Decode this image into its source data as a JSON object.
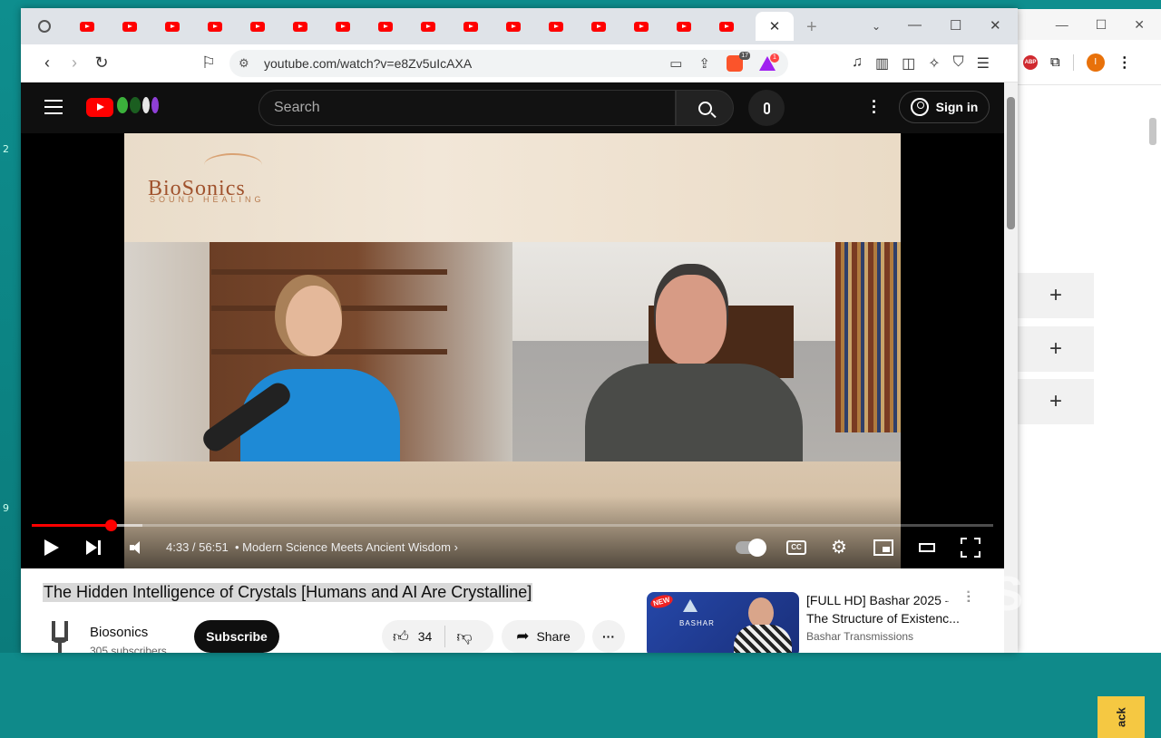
{
  "desktop": {
    "marks": [
      "2",
      "9"
    ]
  },
  "browser": {
    "tabs_count": 16,
    "active_tab_close": "✕",
    "new_tab": "+",
    "window_controls": {
      "minimize": "—",
      "maximize": "☐",
      "close": "✕"
    },
    "address": {
      "url": "youtube.com/watch?v=e8Zv5uIcAXA"
    },
    "brave_shield_count": "17",
    "rewards_count": "1"
  },
  "bg_browser": {
    "plus_rows": [
      "+",
      "+",
      "+"
    ],
    "feedback_label": "ack",
    "profile_initial": "I",
    "abp_label": "ABP"
  },
  "youtube": {
    "search": {
      "placeholder": "Search"
    },
    "sign_in": "Sign in",
    "player": {
      "time": "4:33 / 56:51",
      "chapter": "Modern Science Meets Ancient Wisdom",
      "chapter_chevron": "›",
      "progress_fraction": 0.0818,
      "buffered_fraction": 0.115,
      "cc_label": "CC",
      "video_brand": "BioSonics",
      "video_brand_sub": "SOUND HEALING"
    },
    "video": {
      "title": "The Hidden Intelligence of Crystals [Humans and AI Are Crystalline]",
      "channel": "Biosonics",
      "subscribers": "305 subscribers",
      "subscribe_label": "Subscribe",
      "likes": "34",
      "share_label": "Share",
      "more_label": "···"
    },
    "recommended": [
      {
        "title": "[FULL HD] Bashar 2025 - The Structure of Existenc...",
        "channel": "Bashar Transmissions",
        "thumb_badge": "NEW",
        "thumb_text": "BASHAR"
      }
    ]
  },
  "overlay": {
    "watermark": "InShOt"
  }
}
